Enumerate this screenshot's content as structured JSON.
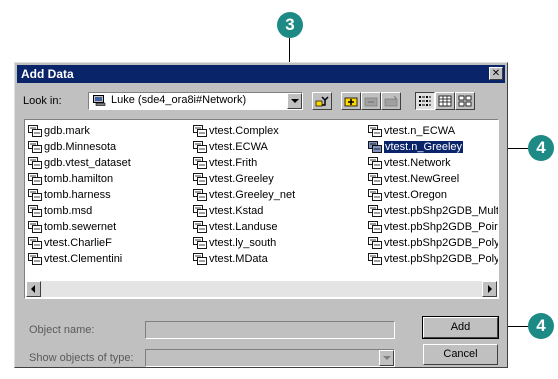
{
  "callouts": {
    "top": "3",
    "right_list": "4",
    "right_add": "4"
  },
  "dialog": {
    "title": "Add Data",
    "close_glyph": "✕",
    "look_in_label": "Look in:",
    "look_in_value": "Luke (sde4_ora8i#Network)",
    "toolbar": [
      "up-one-level-icon",
      "connect-folder-icon",
      "disconnect-folder-icon",
      "new-folder-icon",
      "list-view-icon",
      "details-view-icon",
      "thumbnails-view-icon"
    ],
    "columns": [
      [
        "gdb.mark",
        "gdb.Minnesota",
        "gdb.vtest_dataset",
        "tomb.hamilton",
        "tomb.harness",
        "tomb.msd",
        "tomb.sewernet",
        "vtest.CharlieF",
        "vtest.Clementini"
      ],
      [
        "vtest.Complex",
        "vtest.ECWA",
        "vtest.Frith",
        "vtest.Greeley",
        "vtest.Greeley_net",
        "vtest.Kstad",
        "vtest.Landuse",
        "vtest.ly_south",
        "vtest.MData"
      ],
      [
        "vtest.n_ECWA",
        "vtest.n_Greeley",
        "vtest.Network",
        "vtest.NewGreel",
        "vtest.Oregon",
        "vtest.pbShp2GDB_Mult",
        "vtest.pbShp2GDB_Poir",
        "vtest.pbShp2GDB_Poly",
        "vtest.pbShp2GDB_Poly"
      ]
    ],
    "selected_item": "vtest.n_Greeley",
    "object_name_label": "Object name:",
    "object_name_value": "",
    "show_objects_label": "Show objects of type:",
    "show_objects_value": "",
    "add_label": "Add",
    "cancel_label": "Cancel"
  },
  "colors": {
    "callout": "#1d8a86",
    "titlebar": "#0a246a",
    "face": "#c0c0c0"
  }
}
